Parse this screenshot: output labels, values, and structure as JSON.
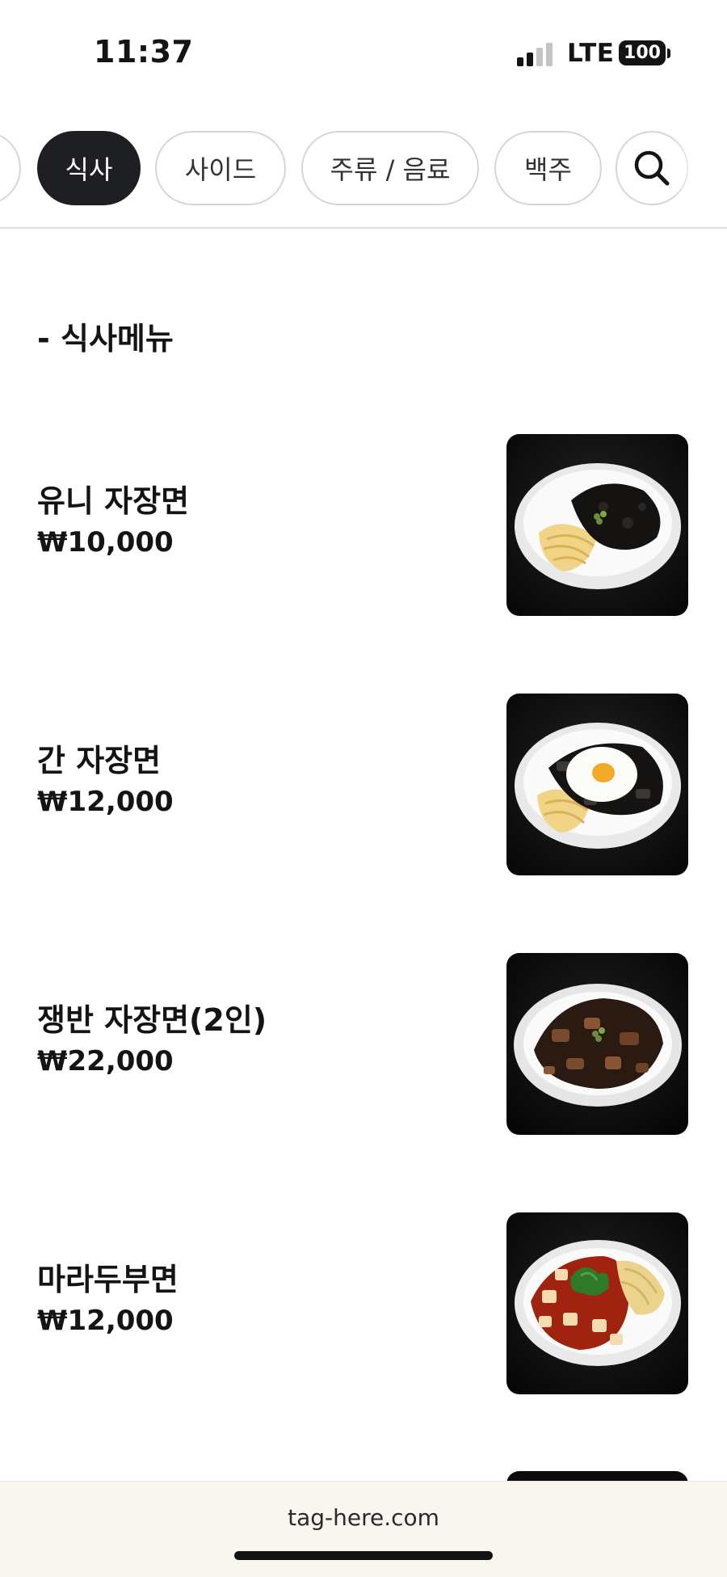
{
  "status_bar": {
    "time": "11:37",
    "network": "LTE",
    "battery": "100",
    "signal_bars_active": 2,
    "signal_bars_total": 4
  },
  "categories": {
    "items": [
      {
        "label": "",
        "active": false
      },
      {
        "label": "식사",
        "active": true
      },
      {
        "label": "사이드",
        "active": false
      },
      {
        "label": "주류 / 음료",
        "active": false
      },
      {
        "label": "백주",
        "active": false
      }
    ],
    "search_icon": "search-icon"
  },
  "menu": {
    "section_title": "- 식사메뉴",
    "items": [
      {
        "name": "유니 자장면",
        "price": "₩10,000",
        "image": "jajangmyeon-photo"
      },
      {
        "name": "간 자장면",
        "price": "₩12,000",
        "image": "gan-jajangmyeon-egg-photo"
      },
      {
        "name": "쟁반 자장면(2인)",
        "price": "₩22,000",
        "image": "jaengban-jajangmyeon-photo"
      },
      {
        "name": "마라두부면",
        "price": "₩12,000",
        "image": "mala-tofu-noodle-photo"
      }
    ]
  },
  "footer": {
    "url": "tag-here.com"
  },
  "colors": {
    "active_pill": "#1e1f22",
    "pill_border": "#d6d6d6",
    "footer_bg": "#f8f6ef"
  }
}
